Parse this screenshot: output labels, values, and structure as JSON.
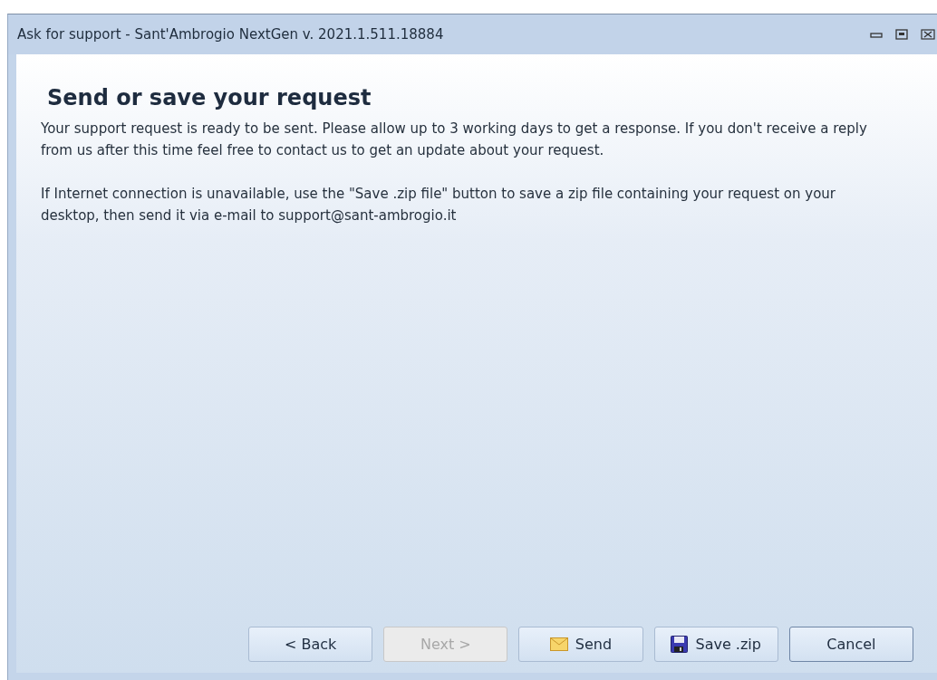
{
  "window": {
    "title": "Ask for support - Sant'Ambrogio NextGen v. 2021.1.511.18884"
  },
  "heading": "Send or save your request",
  "paragraphs": [
    "Your support request is ready to be sent. Please allow up to 3 working days to get a response. If you don't receive a reply from us after this time feel free to contact us to get an update about your request.",
    "If Internet connection is unavailable, use the \"Save .zip file\" button to save a zip file containing your request on your desktop, then send it via e-mail to support@sant-ambrogio.it"
  ],
  "buttons": [
    {
      "label": "< Back",
      "kind": "text",
      "disabled": false,
      "default": false
    },
    {
      "label": "Next >",
      "kind": "text",
      "disabled": true,
      "default": false
    },
    {
      "label": "Send",
      "kind": "mail",
      "disabled": false,
      "default": false
    },
    {
      "label": "Save .zip",
      "kind": "save",
      "disabled": false,
      "default": false
    },
    {
      "label": "Cancel",
      "kind": "text",
      "disabled": false,
      "default": true
    }
  ]
}
